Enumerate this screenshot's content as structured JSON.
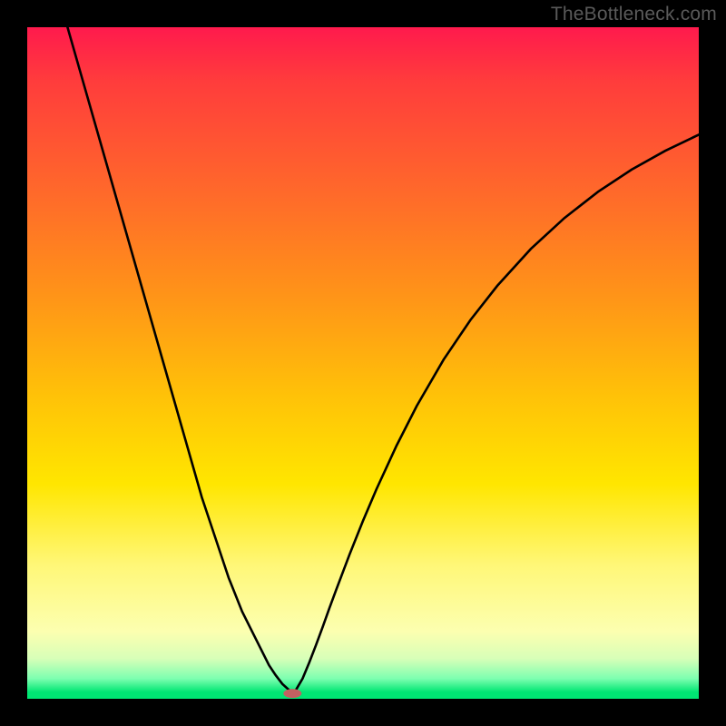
{
  "watermark": {
    "text": "TheBottleneck.com"
  },
  "chart_data": {
    "type": "line",
    "title": "",
    "xlabel": "",
    "ylabel": "",
    "xlim": [
      0,
      100
    ],
    "ylim": [
      0,
      100
    ],
    "grid": false,
    "legend": false,
    "marker": {
      "x_percent": 39.5,
      "y_percent": 99.2,
      "color": "#c26161"
    },
    "series": [
      {
        "name": "bottleneck-curve",
        "color": "#000000",
        "x_percent": [
          6,
          8,
          10,
          12,
          14,
          16,
          18,
          20,
          22,
          24,
          26,
          28,
          30,
          32,
          34,
          36,
          37,
          38,
          39,
          39.5,
          40,
          41,
          42,
          43,
          44,
          45,
          46,
          48,
          50,
          52,
          55,
          58,
          62,
          66,
          70,
          75,
          80,
          85,
          90,
          95,
          100
        ],
        "y_percent": [
          0,
          7,
          14,
          21,
          28,
          35,
          42,
          49,
          56,
          63,
          70,
          76,
          82,
          87,
          91,
          95,
          96.5,
          97.8,
          98.7,
          99.2,
          98.7,
          97,
          94.6,
          92,
          89.3,
          86.5,
          83.8,
          78.5,
          73.5,
          68.8,
          62.3,
          56.4,
          49.5,
          43.6,
          38.5,
          33,
          28.4,
          24.5,
          21.2,
          18.4,
          16
        ]
      }
    ],
    "background_gradient": {
      "stops": [
        {
          "pct": 0,
          "color": "#ff1a4d"
        },
        {
          "pct": 68,
          "color": "#ffe600"
        },
        {
          "pct": 99,
          "color": "#00e673"
        }
      ]
    }
  }
}
